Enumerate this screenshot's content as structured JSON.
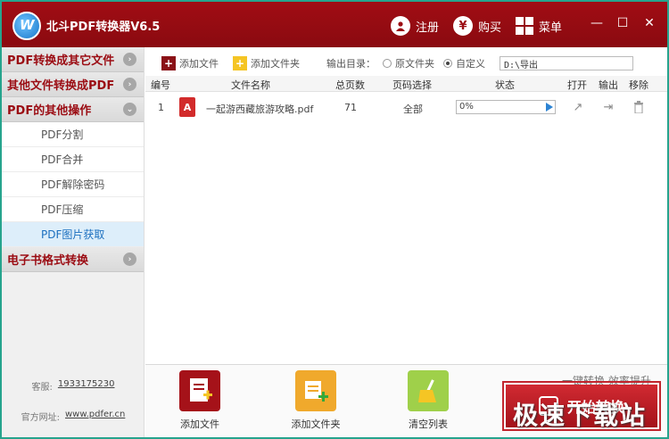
{
  "app": {
    "title": "北斗PDF转换器V6.5",
    "logo_text": "W"
  },
  "titlebar": {
    "register_label": "注册",
    "register_icon": "user-icon",
    "buy_label": "购买",
    "buy_icon": "yen-icon",
    "buy_glyph": "¥",
    "menu_label": "菜单",
    "menu_icon": "grid-icon",
    "window_controls": {
      "minimize": "—",
      "maximize": "☐",
      "close": "✕"
    }
  },
  "sidebar": {
    "categories": [
      {
        "label": "PDF转换成其它文件",
        "arrow": "›"
      },
      {
        "label": "其他文件转换成PDF",
        "arrow": "›"
      },
      {
        "label": "PDF的其他操作",
        "arrow": "⌄"
      }
    ],
    "subitems": [
      {
        "label": "PDF分割"
      },
      {
        "label": "PDF合并"
      },
      {
        "label": "PDF解除密码"
      },
      {
        "label": "PDF压缩"
      },
      {
        "label": "PDF图片获取"
      }
    ],
    "last_category": {
      "label": "电子书格式转换",
      "arrow": "›"
    },
    "contact": {
      "qq_label": "客服:",
      "qq_value": "1933175230",
      "site_label": "官方网址:",
      "site_value": "www.pdfer.cn"
    }
  },
  "toolbar": {
    "add_file": "添加文件",
    "add_folder": "添加文件夹",
    "output_label": "输出目录：",
    "opt_source": "原文件夹",
    "opt_custom": "自定义",
    "output_path": "D:\\导出"
  },
  "table": {
    "headers": [
      "编号",
      "文件名称",
      "总页数",
      "页码选择",
      "状态",
      "打开",
      "输出",
      "移除"
    ],
    "rows": [
      {
        "index": "1",
        "filename": "一起游西藏旅游攻略.pdf",
        "pages": "71",
        "page_select": "全部",
        "status": "0%"
      }
    ]
  },
  "bottom": {
    "add_file": "添加文件",
    "add_folder": "添加文件夹",
    "clear_list": "清空列表",
    "slogan": "一键转换  效率提升",
    "start": "开始转换"
  },
  "watermark": "极速下载站",
  "colors": {
    "brand": "#9b0c13",
    "accent": "#2c83d3",
    "frame": "#26a48d"
  }
}
